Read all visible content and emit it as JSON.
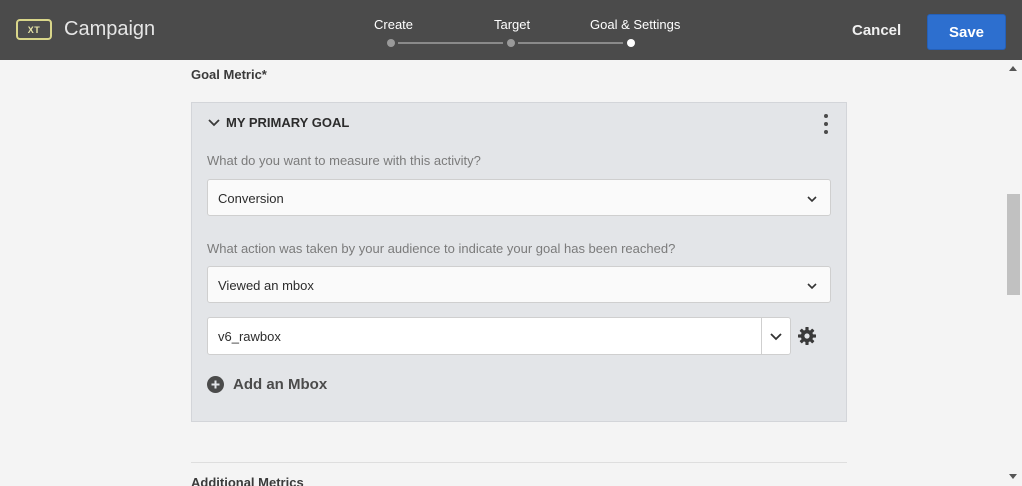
{
  "header": {
    "badge": "XT",
    "title": "Campaign",
    "steps": [
      {
        "label": "Create",
        "state": "complete"
      },
      {
        "label": "Target",
        "state": "complete"
      },
      {
        "label": "Goal & Settings",
        "state": "current"
      }
    ],
    "cancel_label": "Cancel",
    "save_label": "Save"
  },
  "goal_metric": {
    "heading": "Goal Metric*",
    "panel_title": "MY PRIMARY GOAL",
    "measure_question": "What do you want to measure with this activity?",
    "measure_value": "Conversion",
    "action_question": "What action was taken by your audience to indicate your goal has been reached?",
    "action_value": "Viewed an mbox",
    "mbox_value": "v6_rawbox",
    "add_mbox_label": "Add an Mbox"
  },
  "additional_metrics": {
    "heading": "Additional Metrics"
  },
  "colors": {
    "header_bg": "#4b4b4b",
    "primary_button": "#2d6fcf",
    "panel_bg": "#e3e5e8",
    "badge_border": "#d9d68a"
  }
}
